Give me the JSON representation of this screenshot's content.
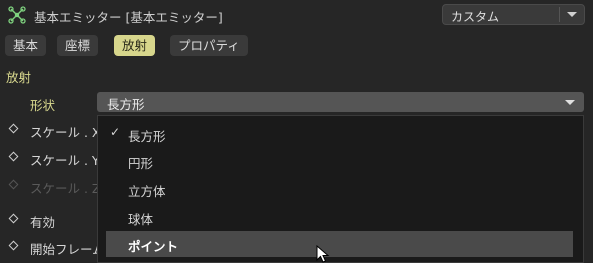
{
  "header": {
    "title": "基本エミッター [基本エミッター]",
    "preset_value": "カスタム"
  },
  "tabs": [
    {
      "label": "基本",
      "active": false
    },
    {
      "label": "座標",
      "active": false
    },
    {
      "label": "放射",
      "active": true
    },
    {
      "label": "プロパティ",
      "active": false
    }
  ],
  "section": {
    "label": "放射",
    "shape_label": "形状",
    "shape_value": "長方形"
  },
  "params": [
    {
      "label": "スケール . X",
      "enabled": true
    },
    {
      "label": "スケール . Y",
      "enabled": true
    },
    {
      "label": "スケール . Z",
      "enabled": false
    },
    {
      "label": "有効",
      "enabled": true
    },
    {
      "label": "開始フレーム",
      "enabled": true
    }
  ],
  "dropdown": {
    "selected": "長方形",
    "hovered": "ポイント",
    "options": [
      "長方形",
      "円形",
      "立方体",
      "球体",
      "ポイント"
    ]
  },
  "icons": {
    "emitter": "emitter-icon",
    "check": "check-icon",
    "cursor": "mouse-cursor-icon"
  }
}
